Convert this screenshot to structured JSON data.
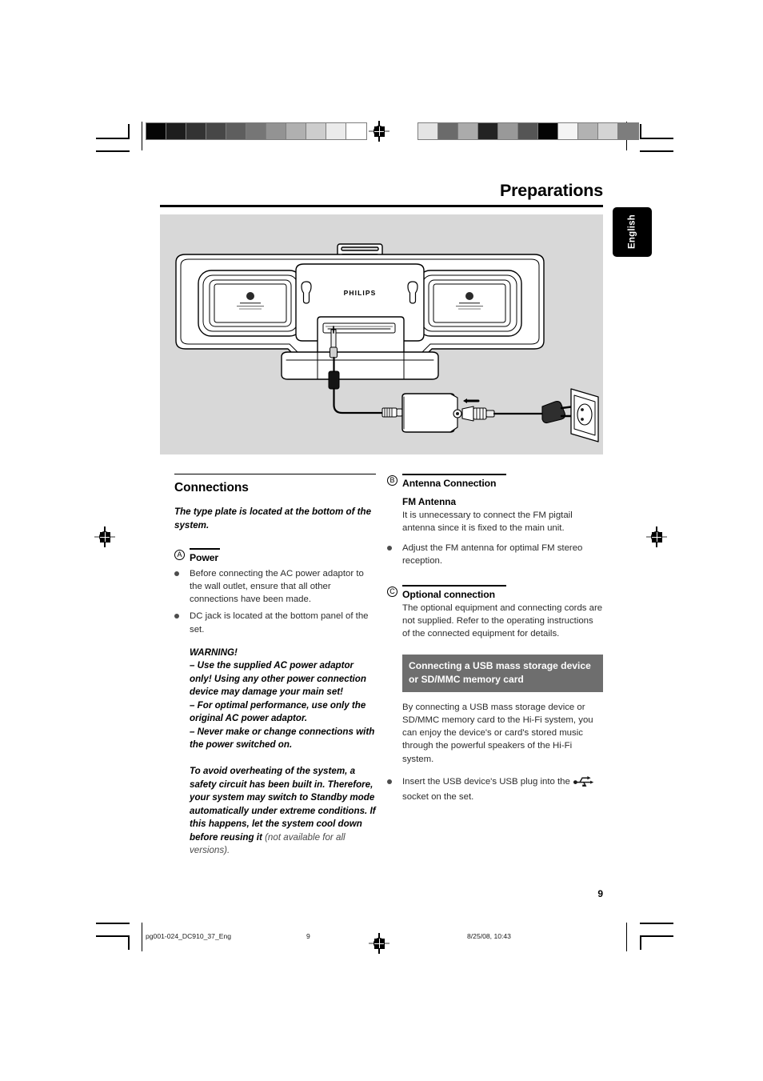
{
  "page": {
    "title": "Preparations",
    "language_tab": "English",
    "page_number": "9"
  },
  "figure": {
    "caption_alt": "Rear view of Philips Hi-Fi main unit with DC jack, AC power adaptor and wall outlet connection diagram",
    "brand_label": "PHILIPS"
  },
  "left_column": {
    "section_title": "Connections",
    "lead": "The type plate is located at the bottom of the system.",
    "power": {
      "marker": "A",
      "heading": "Power",
      "bullets": [
        "Before connecting the AC power adaptor to the wall outlet, ensure that all other connections have been made.",
        "DC jack is located at the bottom panel of the set."
      ]
    },
    "warning": {
      "title": "WARNING!",
      "items": [
        "–  Use the supplied AC power adaptor only! Using any other power connection device may damage your main set!",
        "–  For optimal performance, use only the original AC power adaptor.",
        "–  Never make or change connections with the power switched on."
      ]
    },
    "overheat_note": {
      "bold_part": "To avoid overheating of the system, a safety circuit has been built in.  Therefore, your system may switch to Standby mode automatically under extreme conditions.  If this happens, let the system cool down before reusing it",
      "regular_part": " (not available for all versions)."
    }
  },
  "right_column": {
    "antenna": {
      "marker": "B",
      "heading": "Antenna Connection",
      "sub_heading": "FM Antenna",
      "body": "It is unnecessary to connect the FM pigtail antenna since it is fixed to the main unit.",
      "bullets": [
        "Adjust the FM antenna for optimal FM stereo reception."
      ]
    },
    "optional": {
      "marker": "C",
      "heading": "Optional connection",
      "body": "The optional equipment and connecting cords are not supplied.  Refer to the operating instructions of the connected equipment for details."
    },
    "usb_section": {
      "heading": "Connecting a USB mass storage device or SD/MMC memory card",
      "body": "By connecting a USB mass storage device or SD/MMC memory card to the Hi-Fi system, you can enjoy the device's or card's stored music through the powerful speakers of the Hi-Fi system.",
      "bullet_before_icon": "Insert the USB device's USB plug into the",
      "bullet_after_icon": "socket on the set.",
      "icon_name": "usb-icon"
    }
  },
  "footer": {
    "filename": "pg001-024_DC910_37_Eng",
    "page": "9",
    "timestamp": "8/25/08, 10:43"
  },
  "print_marks": {
    "colorbar_left": [
      "#050505",
      "#1d1d1d",
      "#333333",
      "#474747",
      "#5e5e5e",
      "#767676",
      "#939393",
      "#b0b0b0",
      "#cdcdcd",
      "#ebebeb",
      "#ffffff"
    ],
    "colorbar_right": [
      "#e4e4e4",
      "#6b6b6b",
      "#ababab",
      "#232323",
      "#999999",
      "#555555",
      "#040404",
      "#f4f4f4",
      "#b2b2b2",
      "#d4d4d4",
      "#7d7d7d"
    ]
  },
  "colors": {
    "figure_background": "#d8d8d8",
    "usb_heading_background": "#6e6e6e",
    "language_tab_background": "#000000",
    "body_text": "#2b2b2b"
  }
}
